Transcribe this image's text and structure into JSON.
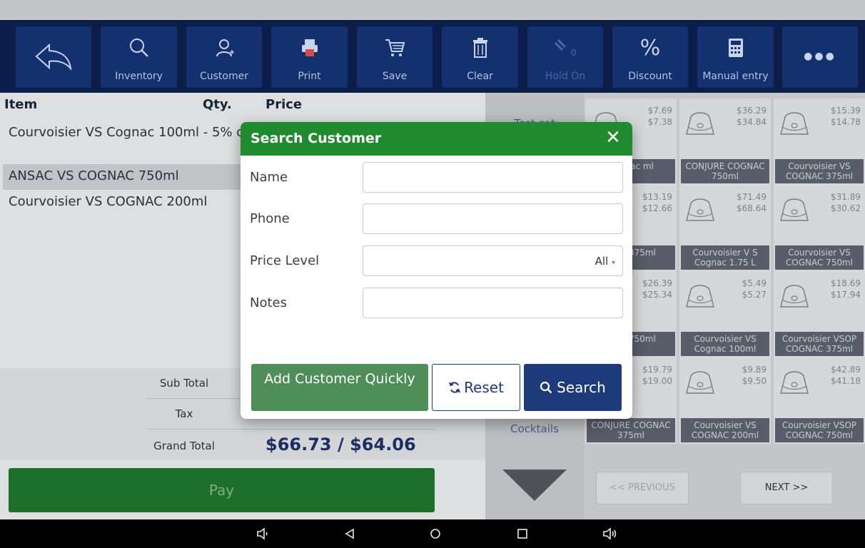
{
  "toolbar": {
    "items": [
      {
        "label": "",
        "icon": "back-arrow-icon"
      },
      {
        "label": "Inventory",
        "icon": "search-icon"
      },
      {
        "label": "Customer",
        "icon": "customer-icon"
      },
      {
        "label": "Print",
        "icon": "printer-icon"
      },
      {
        "label": "Save",
        "icon": "cart-icon"
      },
      {
        "label": "Clear",
        "icon": "trash-icon"
      },
      {
        "label": "Hold On",
        "icon": "hold-icon",
        "badge": "0"
      },
      {
        "label": "Discount",
        "icon": "percent-icon",
        "glyph": "%"
      },
      {
        "label": "Manual entry",
        "icon": "calculator-icon"
      },
      {
        "label": "",
        "icon": "more-icon",
        "glyph": "●●●"
      }
    ]
  },
  "order": {
    "headers": {
      "item": "Item",
      "qty": "Qty.",
      "price": "Price"
    },
    "items": [
      {
        "name": "Courvoisier VS Cognac 100ml - 5% off"
      },
      {
        "name": "ANSAC VS COGNAC 750ml"
      },
      {
        "name": "Courvoisier VS COGNAC 200ml"
      }
    ],
    "totals": {
      "sub_total_label": "Sub Total",
      "tax_label": "Tax",
      "grand_total_label": "Grand Total",
      "grand_total_value": "$66.73 / $64.06"
    },
    "pay_label": "Pay"
  },
  "categories": {
    "visible": [
      "Test cat",
      "Cocktails"
    ]
  },
  "products": [
    {
      "price1": "$7.69",
      "price2": "$7.38",
      "name": "Cognac ml"
    },
    {
      "price1": "$36.29",
      "price2": "$34.84",
      "name": "CONJURE COGNAC 750ml"
    },
    {
      "price1": "$15.39",
      "price2": "$14.78",
      "name": "Courvoisier VS COGNAC 375ml"
    },
    {
      "price1": "$13.19",
      "price2": "$12.66",
      "name": "C VS 375ml"
    },
    {
      "price1": "$71.49",
      "price2": "$68.64",
      "name": "Courvoisier V S Cognac 1.75 L"
    },
    {
      "price1": "$31.89",
      "price2": "$30.62",
      "name": "Courvoisier VS COGNAC 750ml"
    },
    {
      "price1": "$26.39",
      "price2": "$25.34",
      "name": "C VS 750ml"
    },
    {
      "price1": "$5.49",
      "price2": "$5.27",
      "name": "Courvoisier VS Cognac 100ml"
    },
    {
      "price1": "$18.69",
      "price2": "$17.94",
      "name": "Courvoisier VSOP COGNAC 375ml"
    },
    {
      "price1": "$19.79",
      "price2": "$19.00",
      "name": "CONJURE COGNAC 375ml"
    },
    {
      "price1": "$9.89",
      "price2": "$9.50",
      "name": "Courvoisier VS COGNAC 200ml"
    },
    {
      "price1": "$42.89",
      "price2": "$41.18",
      "name": "Courvoisier VSOP COGNAC 750ml"
    }
  ],
  "pager": {
    "previous": "<< PREVIOUS",
    "next": "NEXT >>"
  },
  "dialog": {
    "title": "Search Customer",
    "close_glyph": "✕",
    "fields": {
      "name_label": "Name",
      "name_value": "",
      "phone_label": "Phone",
      "phone_value": "",
      "price_level_label": "Price Level",
      "price_level_value": "All",
      "notes_label": "Notes",
      "notes_value": ""
    },
    "buttons": {
      "add_quickly": "Add Customer Quickly",
      "reset": "Reset",
      "search": "Search"
    }
  },
  "colors": {
    "toolbar_bg": "#0d1d4a",
    "toolbar_button": "#13306f",
    "dialog_header": "#1f8a2e",
    "primary_button": "#1d3a7a",
    "add_button": "#4f8e58",
    "pay_button": "#1d6f2b"
  },
  "system_nav": [
    {
      "icon": "volume-down-icon"
    },
    {
      "icon": "back-icon"
    },
    {
      "icon": "home-icon"
    },
    {
      "icon": "recents-icon"
    },
    {
      "icon": "volume-up-icon"
    }
  ]
}
